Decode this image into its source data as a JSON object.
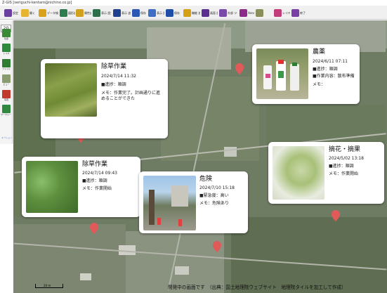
{
  "window": {
    "title": "Z-GIS [seriguchi-kentaro@nichino.co.jp]"
  },
  "toolbar": {
    "buttons": [
      {
        "label": "設定",
        "icon": "gear-icon",
        "color": "#6b3fa0"
      },
      {
        "label": "開く",
        "icon": "folder-open-icon",
        "color": "#e7b431"
      },
      {
        "label": "データ検索",
        "icon": "search-icon",
        "color": "#d9a21b"
      },
      {
        "label": "図形追加",
        "icon": "shape-add-icon",
        "color": "#2f7d4f"
      },
      {
        "label": "属性追加",
        "icon": "table-add-icon",
        "color": "#d0a01e"
      },
      {
        "label": "表示 設定",
        "icon": "display-settings-icon",
        "color": "#2e6e4a"
      },
      {
        "label": "表示 追加",
        "icon": "qr-display-icon",
        "color": "#1f3f8f"
      },
      {
        "label": "保存",
        "icon": "save-icon",
        "color": "#2b57b5"
      },
      {
        "label": "表示 設定",
        "icon": "clipboard-icon",
        "color": "#3e6fc4"
      },
      {
        "label": "保存",
        "icon": "save-disk-icon",
        "color": "#1f4ea8"
      },
      {
        "label": "機能 追加",
        "icon": "grid-icon",
        "color": "#d4a017"
      },
      {
        "label": "画面 設定",
        "icon": "wrench-icon",
        "color": "#5a2f8f"
      },
      {
        "label": "外部 ツール",
        "icon": "tools-icon",
        "color": "#7a4aa8"
      },
      {
        "label": "Xenex",
        "icon": "x-icon",
        "color": "#8b2a8b"
      },
      {
        "label": "",
        "icon": "globe-icon",
        "color": "#8a8f5a"
      },
      {
        "label": "レイヤー",
        "icon": "layer-icon",
        "color": "#c23b7a"
      },
      {
        "label": "終了",
        "icon": "exit-icon",
        "color": "#7a3fa5"
      }
    ]
  },
  "sidebar": {
    "zoom_value": "20",
    "items": [
      {
        "label": "位置",
        "icon": "location-icon",
        "color": "#3a8a3a"
      },
      {
        "label": "レイヤ",
        "icon": "layer-list-icon",
        "color": "#2e8b3e"
      },
      {
        "label": "ファイル",
        "icon": "excel-icon",
        "color": "#2e7d32"
      },
      {
        "label": "ビュー",
        "icon": "photo-view-icon",
        "color": "#8a9b6e"
      },
      {
        "label": "写真",
        "icon": "photo-icon",
        "color": "#c0392b"
      },
      {
        "label": "ワークシート",
        "icon": "worksheet-icon",
        "color": "#2f8a3f"
      }
    ],
    "sub_label": "オプション"
  },
  "cards": [
    {
      "title": "除草作業",
      "date": "2024/7/14 11:32",
      "progress": "■進捗：順調",
      "note": "メモ：作業完了。計画通りに進めることができた",
      "photo": "cut-grass-photo"
    },
    {
      "title": "農薬",
      "date": "2024/6/11 07:11",
      "progress": "■進捗：順調",
      "detail": "■作業内容：散布準備",
      "note": "メモ：",
      "photo": "pesticide-bottles-photo"
    },
    {
      "title": "除草作業",
      "date": "2024/7/14 09:43",
      "progress": "■進捗：順調",
      "note": "メモ：作業開始",
      "photo": "weeds-photo"
    },
    {
      "title": "危険",
      "date": "2024/7/10 15:18",
      "progress": "■緊急度：高い",
      "note": "メモ：危険あり",
      "photo": "construction-site-photo"
    },
    {
      "title": "摘花・摘果",
      "date": "2024/5/02 13:18",
      "progress": "■進捗：順調",
      "note": "メモ：作業開始",
      "photo": "fruit-tree-photo"
    }
  ],
  "map": {
    "pin_color": "#e05a5a",
    "scale_label": "20 m"
  },
  "footer": {
    "text": "開発中の画面です　（出典：国土地理院ウェブサイト　地理院タイルを加工して作成）"
  }
}
